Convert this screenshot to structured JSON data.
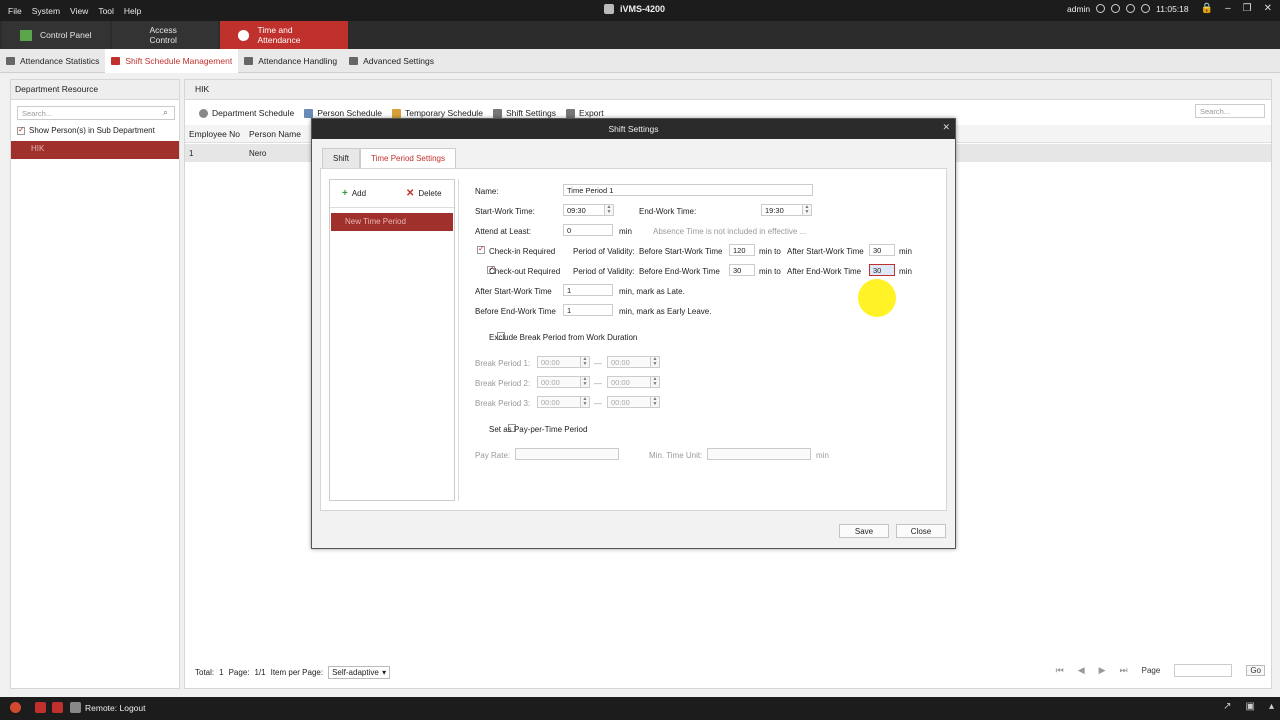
{
  "menu": [
    "File",
    "System",
    "View",
    "Tool",
    "Help"
  ],
  "app_title": "iVMS-4200",
  "top_right": {
    "user": "admin",
    "time": "11:05:18"
  },
  "modules": [
    "Control Panel",
    "Access Control",
    "Time and Attendance"
  ],
  "subtabs": [
    "Attendance Statistics",
    "Shift Schedule Management",
    "Attendance Handling",
    "Advanced Settings"
  ],
  "left": {
    "header": "Department Resource",
    "search_placeholder": "Search...",
    "show_sub": "Show Person(s) in Sub Department",
    "node": "HIK"
  },
  "main": {
    "header": "HIK",
    "toolbar": [
      "Department Schedule",
      "Person Schedule",
      "Temporary Schedule",
      "Shift Settings",
      "Export"
    ],
    "search_placeholder": "Search...",
    "columns": [
      "Employee No",
      "Person Name"
    ],
    "row": {
      "no": "1",
      "name": "Nero"
    },
    "pager": {
      "total_label": "Total:",
      "total": "1",
      "page_label": "Page:",
      "page": "1/1",
      "ipp_label": "Item per Page:",
      "ipp": "Self-adaptive"
    },
    "page_label": "Page",
    "go": "Go"
  },
  "bottom": {
    "remote": "Remote: Logout"
  },
  "dialog": {
    "title": "Shift Settings",
    "tabs": [
      "Shift",
      "Time Period Settings"
    ],
    "add": "Add",
    "delete": "Delete",
    "list_item": "New Time Period",
    "name_label": "Name:",
    "name_value": "Time Period 1",
    "start_label": "Start-Work Time:",
    "start_value": "09:30",
    "end_label": "End-Work Time:",
    "end_value": "19:30",
    "attend_label": "Attend at Least:",
    "attend_value": "0",
    "min": "min",
    "absence_note": "Absence Time is not included in effective ...",
    "checkin_label": "Check-in Required",
    "validity": "Period of Validity:",
    "before_start": "Before Start-Work Time",
    "checkin_before": "120",
    "min_to": "min  to",
    "after_start": "After Start-Work Time",
    "checkin_after": "30",
    "checkout_label": "Check-out Required",
    "before_end": "Before End-Work Time",
    "checkout_before": "30",
    "after_end": "After End-Work Time",
    "checkout_after": "30",
    "late_label": "After Start-Work Time",
    "late_value": "1",
    "late_suffix": "min,  mark as Late.",
    "early_label": "Before End-Work Time",
    "early_value": "1",
    "early_suffix": "min,  mark as Early Leave.",
    "exclude_break": "Exclude Break Period from Work Duration",
    "break1": "Break Period  1:",
    "break2": "Break Period  2:",
    "break3": "Break Period  3:",
    "time_zero": "00:00",
    "dash": "—",
    "pay_per_time": "Set as Pay-per-Time Period",
    "pay_rate": "Pay Rate:",
    "min_time_unit": "Min. Time Unit:",
    "save": "Save",
    "close": "Close"
  }
}
